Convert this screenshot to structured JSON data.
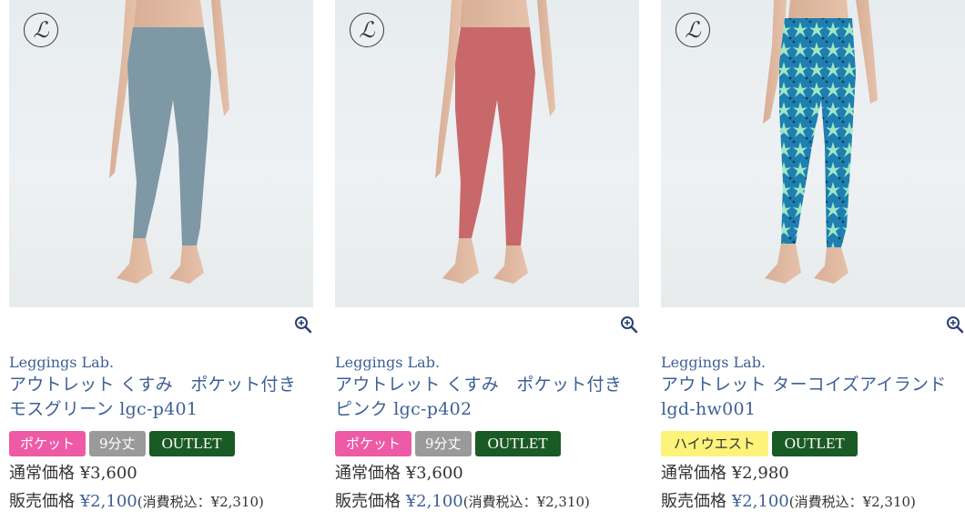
{
  "products": [
    {
      "brand": "Leggings Lab.",
      "title": "アウトレット くすみ　ポケット付き　モスグリーン lgc-p401",
      "tags": [
        {
          "label": "ポケット",
          "type": "pocket"
        },
        {
          "label": "9分丈",
          "type": "length"
        },
        {
          "label": "OUTLET",
          "type": "outlet"
        }
      ],
      "regular_label": "通常価格",
      "regular_price": "¥3,600",
      "sale_label": "販売価格",
      "sale_price": "¥2,100",
      "tax_text": "(消費税込：¥2,310)",
      "legging_color": "#7f98a5",
      "icons": {
        "logo": "brand-logo-icon",
        "zoom": "zoom-in-icon"
      }
    },
    {
      "brand": "Leggings Lab.",
      "title": "アウトレット くすみ　ポケット付き　ピンク lgc-p402",
      "tags": [
        {
          "label": "ポケット",
          "type": "pocket"
        },
        {
          "label": "9分丈",
          "type": "length"
        },
        {
          "label": "OUTLET",
          "type": "outlet"
        }
      ],
      "regular_label": "通常価格",
      "regular_price": "¥3,600",
      "sale_label": "販売価格",
      "sale_price": "¥2,100",
      "tax_text": "(消費税込：¥2,310)",
      "legging_color": "#c9686a",
      "icons": {
        "logo": "brand-logo-icon",
        "zoom": "zoom-in-icon"
      }
    },
    {
      "brand": "Leggings Lab.",
      "title": "アウトレット ターコイズアイランド lgd-hw001",
      "tags": [
        {
          "label": "ハイウエスト",
          "type": "highwaist"
        },
        {
          "label": "OUTLET",
          "type": "outlet"
        }
      ],
      "regular_label": "通常価格",
      "regular_price": "¥2,980",
      "sale_label": "販売価格",
      "sale_price": "¥2,100",
      "tax_text": "(消費税込：¥2,310)",
      "legging_color": "#1e7fb0",
      "icons": {
        "logo": "brand-logo-icon",
        "zoom": "zoom-in-icon"
      }
    }
  ],
  "colors": {
    "link": "#3d5f95",
    "pocket_tag": "#ee5aa6",
    "length_tag": "#9a9a9a",
    "outlet_tag": "#1a5a24",
    "highwaist_tag": "#fdf27a"
  }
}
